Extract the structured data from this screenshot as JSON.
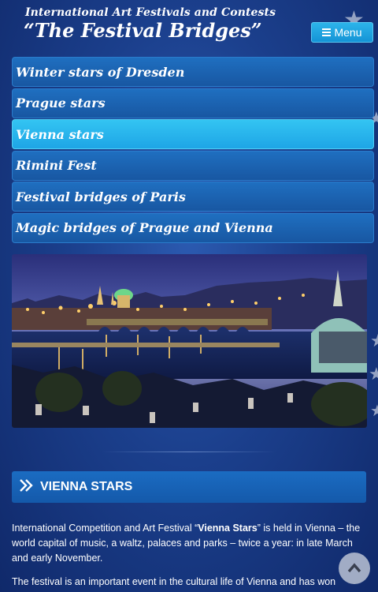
{
  "header": {
    "subtitle": "International Art Festivals and Contests",
    "title": "“The Festival Bridges”",
    "menu_label": "Menu"
  },
  "nav": {
    "items": [
      {
        "label": "Winter stars of Dresden",
        "active": false
      },
      {
        "label": "Prague stars",
        "active": false
      },
      {
        "label": "Vienna stars",
        "active": true
      },
      {
        "label": "Rimini Fest",
        "active": false
      },
      {
        "label": "Festival bridges of Paris",
        "active": false
      },
      {
        "label": "Magic bridges of Prague and Vienna",
        "active": false
      }
    ]
  },
  "section": {
    "title": "VIENNA STARS"
  },
  "content": {
    "p1_before": "International Competition and Art Festival “",
    "p1_bold": "Vienna Stars",
    "p1_after": "” is held in Vienna – the world capital of music, a waltz, palaces and parks – twice a year: in late March and early November.",
    "p2": "The festival is an important event in the cultural life of Vienna and has won"
  },
  "colors": {
    "background": "#1b3f8c",
    "nav_item": "#1857a2",
    "nav_active": "#33c4f2",
    "menu_button": "#1ea5e6"
  },
  "icons": {
    "menu": "bars-icon",
    "section": "double-chevron-right-icon",
    "scroll_top": "chevron-up-icon"
  }
}
